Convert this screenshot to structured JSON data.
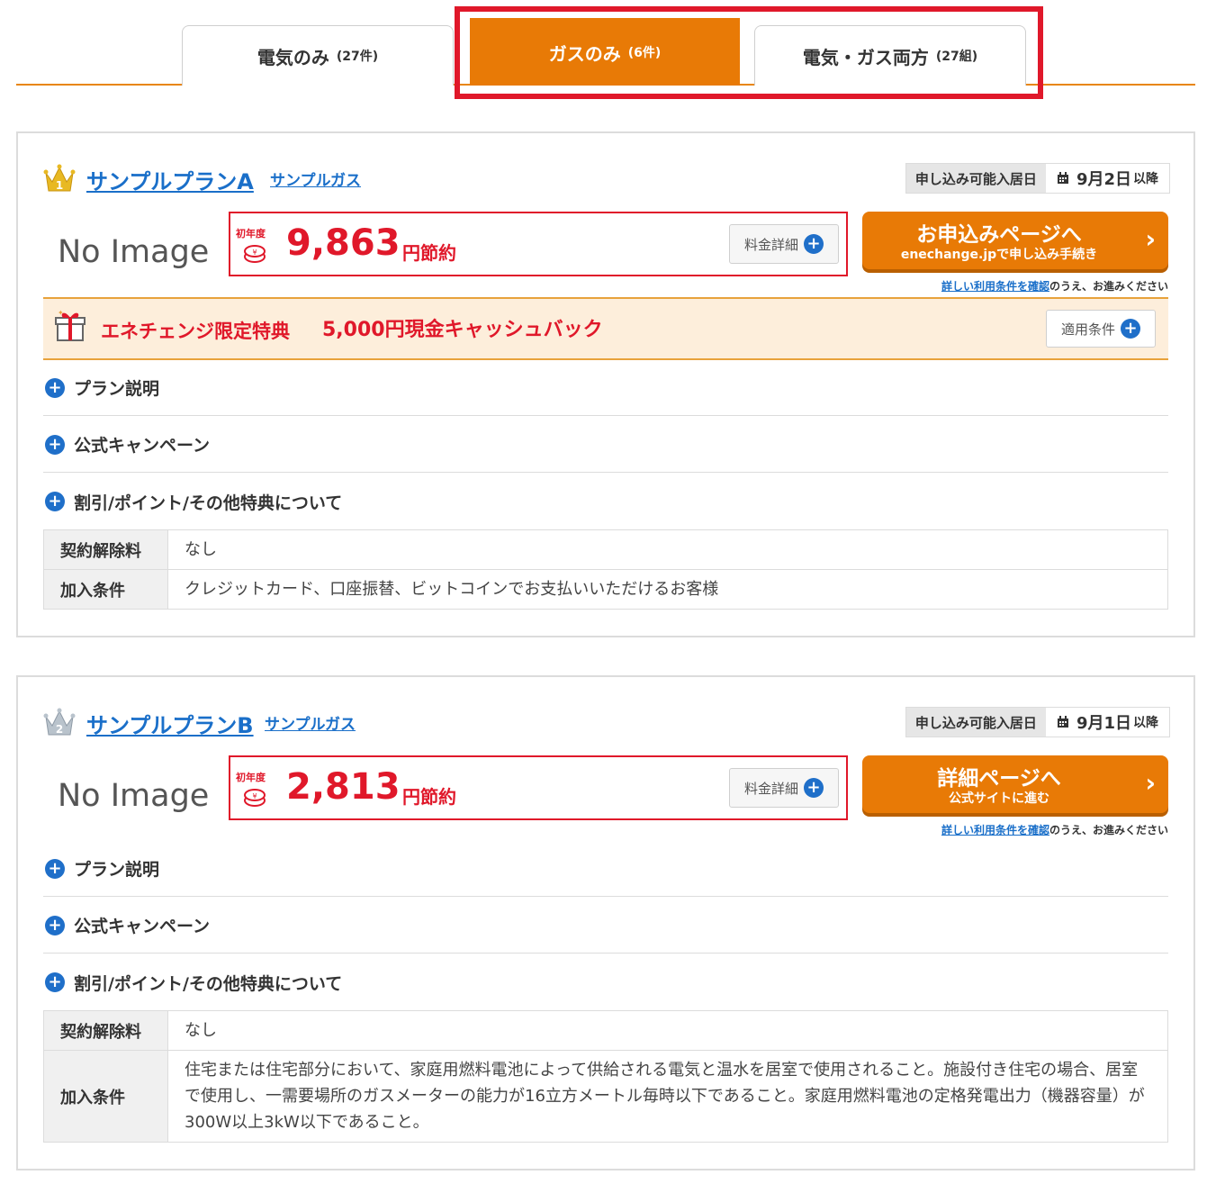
{
  "tabs": [
    {
      "label": "電気のみ",
      "count": "(27件)"
    },
    {
      "label": "ガスのみ",
      "count": "(6件)"
    },
    {
      "label": "電気・ガス両方",
      "count": "(27組)"
    }
  ],
  "plans": [
    {
      "rank": "1",
      "name": "サンプルプランA",
      "supplier": "サンプルガス",
      "movein_label": "申し込み可能入居日",
      "movein_date": "9月2日",
      "movein_suffix": "以降",
      "no_image": "No Image",
      "first_year": "初年度",
      "amount": "9,863",
      "amount_suffix": "円節約",
      "fee_detail": "料金詳細",
      "button_main": "お申込みページへ",
      "button_sub": "enechange.jpで申し込み手続き",
      "terms_link": "詳しい利用条件を確認",
      "terms_rest": "のうえ、お進みください",
      "benefit_title": "エネチェンジ限定特典",
      "benefit_text": "5,000円現金キャッシュバック",
      "benefit_cond": "適用条件",
      "accordions": [
        "プラン説明",
        "公式キャンペーン",
        "割引/ポイント/その他特典について"
      ],
      "table": [
        {
          "key": "契約解除料",
          "value": "なし"
        },
        {
          "key": "加入条件",
          "value": "クレジットカード、口座振替、ビットコインでお支払いいただけるお客様"
        }
      ]
    },
    {
      "rank": "2",
      "name": "サンプルプランB",
      "supplier": "サンプルガス",
      "movein_label": "申し込み可能入居日",
      "movein_date": "9月1日",
      "movein_suffix": "以降",
      "no_image": "No Image",
      "first_year": "初年度",
      "amount": "2,813",
      "amount_suffix": "円節約",
      "fee_detail": "料金詳細",
      "button_main": "詳細ページへ",
      "button_sub": "公式サイトに進む",
      "terms_link": "詳しい利用条件を確認",
      "terms_rest": "のうえ、お進みください",
      "accordions": [
        "プラン説明",
        "公式キャンペーン",
        "割引/ポイント/その他特典について"
      ],
      "table": [
        {
          "key": "契約解除料",
          "value": "なし"
        },
        {
          "key": "加入条件",
          "value": "住宅または住宅部分において、家庭用燃料電池によって供給される電気と温水を居室で使用されること。施設付き住宅の場合、居室で使用し、一需要場所のガスメーターの能力が16立方メートル毎時以下であること。家庭用燃料電池の定格発電出力（機器容量）が300W以上3kW以下であること。"
        }
      ]
    }
  ],
  "colors": {
    "accent": "#e87a06",
    "highlight": "#e0182a",
    "link": "#1a6fc9"
  }
}
